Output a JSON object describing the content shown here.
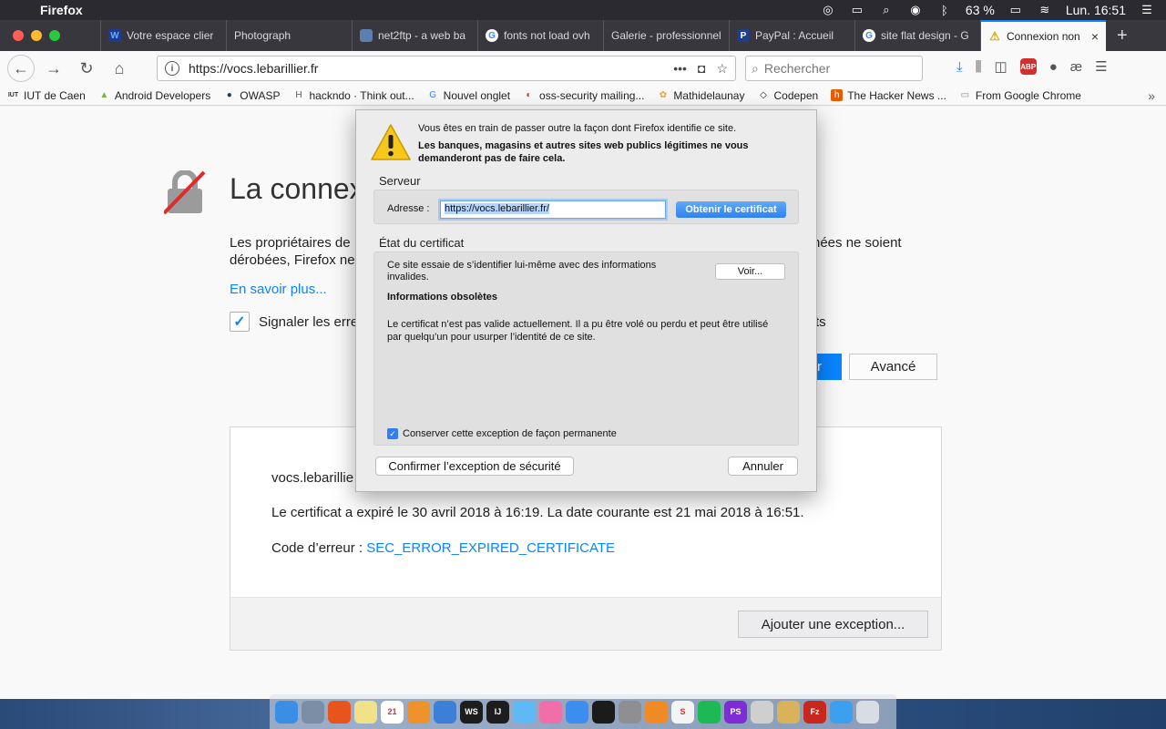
{
  "menubar": {
    "app_name": "Firefox",
    "battery": "63 %",
    "clock": "Lun. 16:51"
  },
  "tabs": [
    {
      "label": "Votre espace clier",
      "icon": "ovh-icon",
      "color": "#1a3d8f"
    },
    {
      "label": "Photograph",
      "icon": "none",
      "color": "#38373d"
    },
    {
      "label": "net2ftp - a web ba",
      "icon": "net2ftp-icon",
      "color": "#5b7fae"
    },
    {
      "label": "fonts not load ovh",
      "icon": "google-icon",
      "color": "#ffffff"
    },
    {
      "label": "Galerie - professionnel",
      "icon": "none",
      "color": "#38373d"
    },
    {
      "label": "PayPal : Accueil",
      "icon": "paypal-icon",
      "color": "#1f3f8a"
    },
    {
      "label": "site flat design - G",
      "icon": "google-icon",
      "color": "#ffffff"
    },
    {
      "label": "Connexion non",
      "icon": "warning-icon",
      "color": "#f9f9fa",
      "active": true
    }
  ],
  "toolbar": {
    "url": "https://vocs.lebarillier.fr",
    "search_placeholder": "Rechercher"
  },
  "bookmarks": [
    {
      "label": "IUT de Caen",
      "icon": "iut-icon"
    },
    {
      "label": "Android Developers",
      "icon": "android-icon"
    },
    {
      "label": "OWASP",
      "icon": "owasp-icon"
    },
    {
      "label": "hackndo · Think out...",
      "icon": "hackndo-icon"
    },
    {
      "label": "Nouvel onglet",
      "icon": "google-icon"
    },
    {
      "label": "oss-security mailing...",
      "icon": "oss-icon"
    },
    {
      "label": "Mathidelaunay",
      "icon": "leaf-icon"
    },
    {
      "label": "Codepen",
      "icon": "codepen-icon"
    },
    {
      "label": "The Hacker News ...",
      "icon": "hackernews-icon"
    },
    {
      "label": "From Google Chrome",
      "icon": "folder-icon"
    }
  ],
  "error_page": {
    "title": "La connex",
    "desc_line1": "Les propriétaires de",
    "desc_line1_tail": "nées ne soient",
    "desc_line2": "dérobées, Firefox ne",
    "learn_more": "En savoir plus...",
    "report_label": "Signaler les erre",
    "report_tail": "ts",
    "back_btn_partial": "r",
    "advanced_btn": "Avancé",
    "site": "vocs.lebarillie",
    "explanation": "Le certificat a expiré le 30 avril 2018 à 16:19. La date courante est 21 mai 2018 à 16:51.",
    "code_label": "Code d’erreur : ",
    "code_value": "SEC_ERROR_EXPIRED_CERTIFICATE",
    "add_exception_btn": "Ajouter une exception..."
  },
  "dialog": {
    "message": "Vous êtes en train de passer outre la façon dont Firefox identifie ce site.",
    "warning_bold": "Les banques, magasins et autres sites web publics légitimes ne vous demanderont pas de faire cela.",
    "server_title": "Serveur",
    "address_label": "Adresse :",
    "address_value": "https://vocs.lebarillier.fr/",
    "get_cert_btn": "Obtenir le certificat",
    "cert_status_title": "État du certificat",
    "cert_invalid_text": "Ce site essaie de s’identifier lui-même avec des informations invalides.",
    "view_btn": "Voir...",
    "outdated_title": "Informations obsolètes",
    "outdated_body": "Le certificat n’est pas valide actuellement. Il a pu être volé ou perdu et peut être utilisé par quelqu’un pour usurper l’identité de ce site.",
    "permanent_label": "Conserver cette exception de façon permanente",
    "confirm_btn": "Confirmer l’exception de sécurité",
    "cancel_btn": "Annuler"
  },
  "dock": [
    {
      "name": "finder",
      "color": "#3a8ee6"
    },
    {
      "name": "preview",
      "color": "#7c8da6"
    },
    {
      "name": "firefox",
      "color": "#e8541c"
    },
    {
      "name": "notes",
      "color": "#f1e28a"
    },
    {
      "name": "calendar",
      "color": "#ffffff",
      "label": "21"
    },
    {
      "name": "ibooks",
      "color": "#f0922b"
    },
    {
      "name": "xcode",
      "color": "#3c7fd6"
    },
    {
      "name": "webstorm",
      "color": "#1d1d1d",
      "label": "WS"
    },
    {
      "name": "intellij",
      "color": "#1d1d1d",
      "label": "IJ"
    },
    {
      "name": "messages",
      "color": "#5fb9f7"
    },
    {
      "name": "itunes",
      "color": "#f06fa8"
    },
    {
      "name": "appstore",
      "color": "#3b8ef0"
    },
    {
      "name": "terminal",
      "color": "#1b1b1b"
    },
    {
      "name": "preferences",
      "color": "#8f8f92"
    },
    {
      "name": "sublime",
      "color": "#f08a24"
    },
    {
      "name": "scrivener",
      "color": "#f4f4f4",
      "label": "S"
    },
    {
      "name": "spotify",
      "color": "#1db954"
    },
    {
      "name": "phpstorm",
      "color": "#7f2cd6",
      "label": "PS"
    },
    {
      "name": "sequel",
      "color": "#cfcfcf"
    },
    {
      "name": "database",
      "color": "#d9b25a"
    },
    {
      "name": "filezilla",
      "color": "#c7271c",
      "label": "Fz"
    },
    {
      "name": "safari",
      "color": "#3da0ef"
    },
    {
      "name": "trash",
      "color": "#d8dde4"
    }
  ]
}
